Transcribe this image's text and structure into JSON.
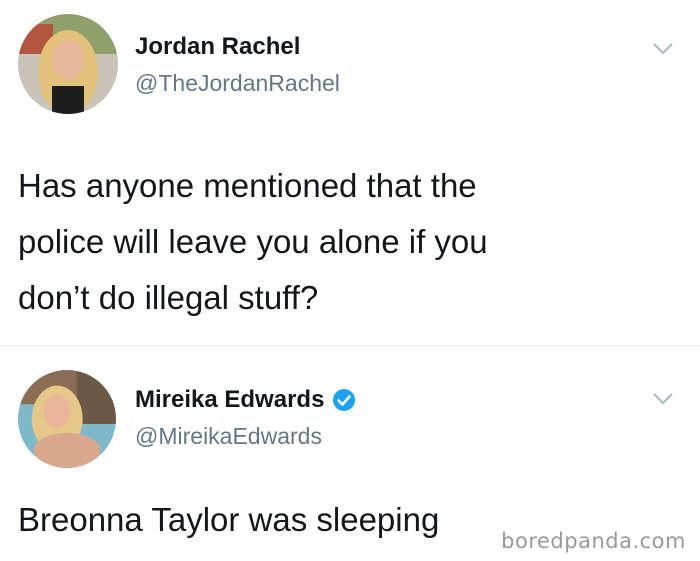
{
  "tweets": [
    {
      "display_name": "Jordan Rachel",
      "handle": "@TheJordanRachel",
      "verified": false,
      "text": "Has anyone mentioned that the\npolice will leave you alone if you\ndon’t do illegal stuff?"
    },
    {
      "display_name": "Mireika Edwards",
      "handle": "@MireikaEdwards",
      "verified": true,
      "text": "Breonna Taylor was sleeping"
    }
  ],
  "watermark": "boredpanda.com",
  "icons": {
    "verified": "verified-badge-icon",
    "menu": "chevron-down-icon"
  },
  "colors": {
    "text": "#14171a",
    "handle": "#657786",
    "verified": "#1da1f2",
    "chevron": "#aab8c2"
  }
}
